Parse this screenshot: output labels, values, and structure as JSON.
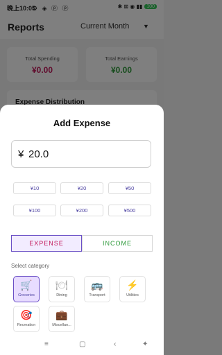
{
  "status_bar": {
    "time": "晚上10:05",
    "left_icons": "⚙ ◈ ⓟ ⓟ",
    "right_icons": "✱ ⊠ ◉ ▮▮",
    "battery": "100"
  },
  "header": {
    "title": "Reports",
    "period": "Current Month",
    "caret": "▼"
  },
  "summary": {
    "spending": {
      "label": "Total Spending",
      "value": "¥0.00",
      "color": "#c2185b"
    },
    "earnings": {
      "label": "Total Earnings",
      "value": "¥0.00",
      "color": "#2e9a3b"
    }
  },
  "distribution": {
    "title": "Expense Distribution"
  },
  "sheet": {
    "title": "Add Expense",
    "currency": "¥",
    "amount": "20.0",
    "quick_amounts": [
      "¥10",
      "¥20",
      "¥50",
      "¥100",
      "¥200",
      "¥500"
    ],
    "tabs": {
      "expense": "EXPENSE",
      "income": "INCOME",
      "selected": "expense"
    },
    "select_category_label": "Select category",
    "categories": [
      {
        "label": "Groceries",
        "icon": "cart-icon",
        "glyph": "🛒",
        "selected": true
      },
      {
        "label": "Dining",
        "icon": "dining-icon",
        "glyph": "🍽",
        "selected": false
      },
      {
        "label": "Transport",
        "icon": "bus-icon",
        "glyph": "🚌",
        "selected": false
      },
      {
        "label": "Utilities",
        "icon": "lightning-icon",
        "glyph": "⚡",
        "selected": false
      },
      {
        "label": "Recreation",
        "icon": "target-icon",
        "glyph": "🎯",
        "selected": false
      },
      {
        "label": "Miscellan...",
        "icon": "briefcase-icon",
        "glyph": "💼",
        "selected": false
      }
    ]
  },
  "nav": {
    "menu": "≡",
    "home": "▢",
    "back": "‹",
    "accessibility": "✦"
  },
  "colors": {
    "accent": "#6a4fc6",
    "expense": "#c2185b",
    "income": "#2e9a3b"
  }
}
